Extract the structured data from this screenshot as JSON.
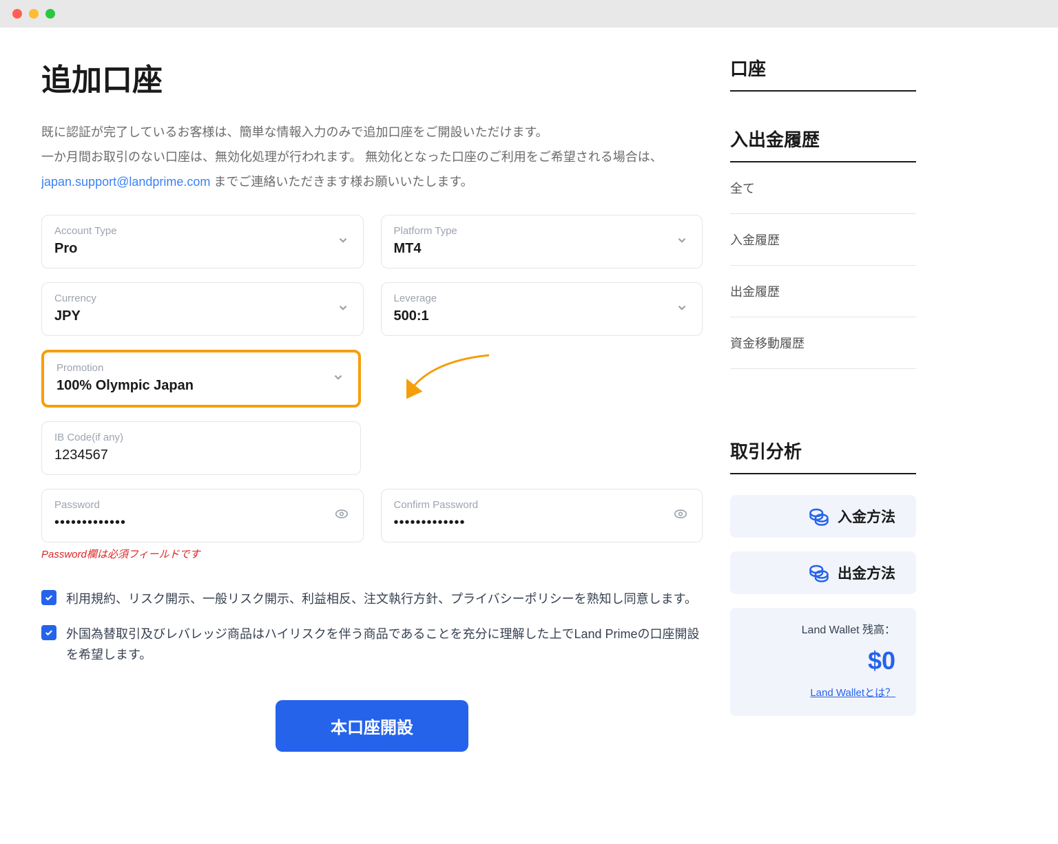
{
  "page": {
    "title": "追加口座",
    "intro_line1": "既に認証が完了しているお客様は、簡単な情報入力のみで追加口座をご開設いただけます。",
    "intro_line2": "一か月間お取引のない口座は、無効化処理が行われます。 無効化となった口座のご利用をご希望される場合は、",
    "intro_email": "japan.support@landprime.com",
    "intro_line3": " までご連絡いただきます様お願いいたします。"
  },
  "form": {
    "account_type": {
      "label": "Account Type",
      "value": "Pro"
    },
    "platform_type": {
      "label": "Platform Type",
      "value": "MT4"
    },
    "currency": {
      "label": "Currency",
      "value": "JPY"
    },
    "leverage": {
      "label": "Leverage",
      "value": "500:1"
    },
    "promotion": {
      "label": "Promotion",
      "value": "100% Olympic Japan"
    },
    "ib_code": {
      "label": "IB Code(if any)",
      "value": "1234567"
    },
    "password": {
      "label": "Password",
      "value": "•••••••••••••",
      "error": "Password欄は必須フィールドです"
    },
    "confirm_password": {
      "label": "Confirm Password",
      "value": "•••••••••••••"
    },
    "checkbox1": "利用規約、リスク開示、一般リスク開示、利益相反、注文執行方針、プライバシーポリシーを熟知し同意します。",
    "checkbox2": "外国為替取引及びレバレッジ商品はハイリスクを伴う商品であることを充分に理解した上でLand Primeの口座開設を希望します。",
    "submit": "本口座開設"
  },
  "sidebar": {
    "heading_account": "口座",
    "heading_history": "入出金履歴",
    "history": {
      "all": "全て",
      "deposit": "入金履歴",
      "withdraw": "出金履歴",
      "transfer": "資金移動履歴"
    },
    "heading_analysis": "取引分析",
    "btn_deposit": "入金方法",
    "btn_withdraw": "出金方法",
    "wallet": {
      "label": "Land Wallet 残高：",
      "balance": "$0",
      "link": "Land Walletとは？"
    }
  }
}
